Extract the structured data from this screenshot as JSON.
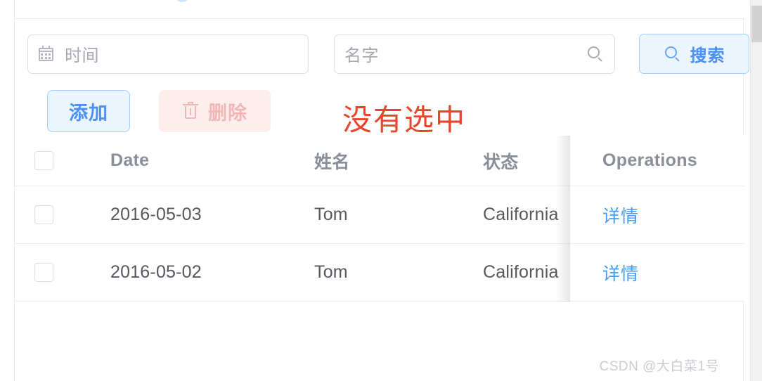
{
  "filters": {
    "date_placeholder": "时间",
    "date_icon": "calendar-icon",
    "name_placeholder": "名字",
    "name_icon": "search-icon",
    "search_button_label": "搜索",
    "search_button_icon": "search-icon"
  },
  "actions": {
    "add_label": "添加",
    "delete_label": "删除",
    "delete_icon": "trash-icon",
    "annotation": "没有选中",
    "annotation_color": "#e8452b",
    "primary_color": "#409eff",
    "danger_color": "#f56c6c"
  },
  "table": {
    "columns": {
      "select": "",
      "date": "Date",
      "name": "姓名",
      "state": "状态",
      "operations": "Operations"
    },
    "rows": [
      {
        "date": "2016-05-03",
        "name": "Tom",
        "state": "California",
        "operation": "详情"
      },
      {
        "date": "2016-05-02",
        "name": "Tom",
        "state": "California",
        "operation": "详情"
      }
    ]
  },
  "watermark": "CSDN @大白菜1号"
}
